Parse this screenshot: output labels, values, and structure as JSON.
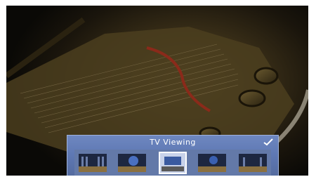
{
  "dialog": {
    "title": "TV Viewing",
    "confirm_icon": "checkmark-icon"
  },
  "thumbnails": [
    {
      "icon": "theater-seats-icon",
      "selected": false
    },
    {
      "icon": "globe-scene-icon",
      "selected": false
    },
    {
      "icon": "tv-viewing-icon",
      "selected": true
    },
    {
      "icon": "globe-seats-icon",
      "selected": false
    },
    {
      "icon": "hall-seats-icon",
      "selected": false
    }
  ],
  "colors": {
    "panel": "#5e78b3",
    "panel_border": "#9fb2da",
    "text": "#ffffff"
  }
}
